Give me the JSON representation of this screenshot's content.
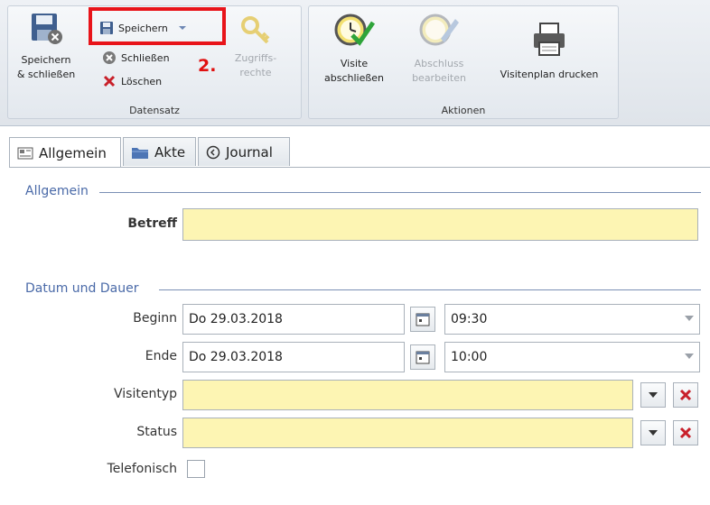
{
  "ribbon": {
    "datensatz": {
      "group_label": "Datensatz",
      "save_close_label_line1": "Speichern",
      "save_close_label_line2": "& schließen",
      "speichern_label": "Speichern",
      "schliessen_label": "Schließen",
      "loeschen_label": "Löschen",
      "zugriff_line1": "Zugriffs-",
      "zugriff_line2": "rechte"
    },
    "aktionen": {
      "group_label": "Aktionen",
      "visite_line1": "Visite",
      "visite_line2": "abschließen",
      "abschluss_line1": "Abschluss",
      "abschluss_line2": "bearbeiten",
      "visitenplan_label": "Visitenplan drucken"
    }
  },
  "annotation": "2.",
  "tabs": [
    {
      "label": "Allgemein"
    },
    {
      "label": "Akte"
    },
    {
      "label": "Journal"
    }
  ],
  "sections": {
    "allgemein": "Allgemein",
    "datum": "Datum und Dauer"
  },
  "form": {
    "betreff_label": "Betreff",
    "betreff_value": "",
    "beginn_label": "Beginn",
    "beginn_date": "Do 29.03.2018",
    "beginn_time": "09:30",
    "ende_label": "Ende",
    "ende_date": "Do 29.03.2018",
    "ende_time": "10:00",
    "visitentyp_label": "Visitentyp",
    "status_label": "Status",
    "telefonisch_label": "Telefonisch"
  },
  "colors": {
    "highlight_box": "#e8141a",
    "required_field": "#fdf5b3",
    "section_title": "#4a6aa8"
  }
}
